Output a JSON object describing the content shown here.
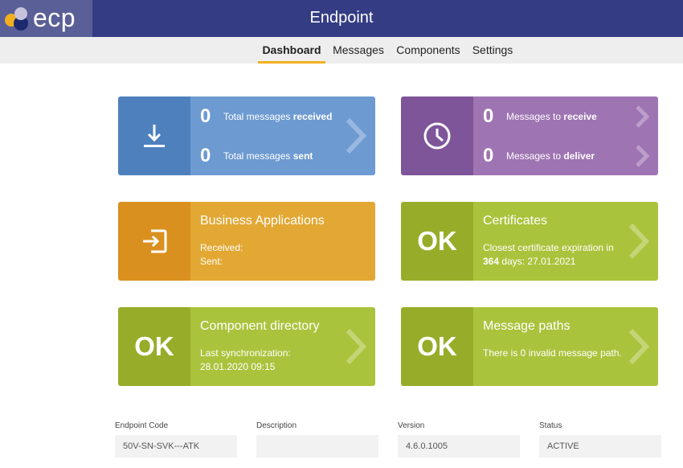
{
  "app": {
    "logo_text": "ecp",
    "title": "Endpoint"
  },
  "nav": {
    "tabs": [
      {
        "label": "Dashboard",
        "active": true
      },
      {
        "label": "Messages",
        "active": false
      },
      {
        "label": "Components",
        "active": false
      },
      {
        "label": "Settings",
        "active": false
      }
    ]
  },
  "tiles": {
    "totals": {
      "received_count": "0",
      "received_prefix": "Total messages ",
      "received_bold": "received",
      "sent_count": "0",
      "sent_prefix": "Total messages ",
      "sent_bold": "sent",
      "icon": "download-icon"
    },
    "queue": {
      "receive_count": "0",
      "receive_prefix": "Messages to ",
      "receive_bold": "receive",
      "deliver_count": "0",
      "deliver_prefix": "Messages to ",
      "deliver_bold": "deliver",
      "icon": "clock-icon"
    },
    "business": {
      "title": "Business Applications",
      "received_label": "Received:",
      "sent_label": "Sent:",
      "icon": "sign-in-icon"
    },
    "certificates": {
      "status": "OK",
      "title": "Certificates",
      "line1": "Closest certificate expiration in",
      "days": "364",
      "line2_suffix": " days: 27.01.2021"
    },
    "component_directory": {
      "status": "OK",
      "title": "Component directory",
      "line1": "Last synchronization:",
      "line2": "28.01.2020 09:15"
    },
    "message_paths": {
      "status": "OK",
      "title": "Message paths",
      "line1": "There is 0 invalid message path."
    }
  },
  "footer": {
    "fields": [
      {
        "label": "Endpoint Code",
        "value": "50V-SN-SVK---ATK"
      },
      {
        "label": "Description",
        "value": ""
      },
      {
        "label": "Version",
        "value": "4.6.0.1005"
      },
      {
        "label": "Status",
        "value": "ACTIVE"
      }
    ]
  },
  "colors": {
    "header": "#343c84",
    "nav_active_underline": "#f2b01e",
    "blue": "#6d9ad1",
    "purple": "#9e74b3",
    "orange": "#e2a833",
    "green": "#aac33c"
  }
}
